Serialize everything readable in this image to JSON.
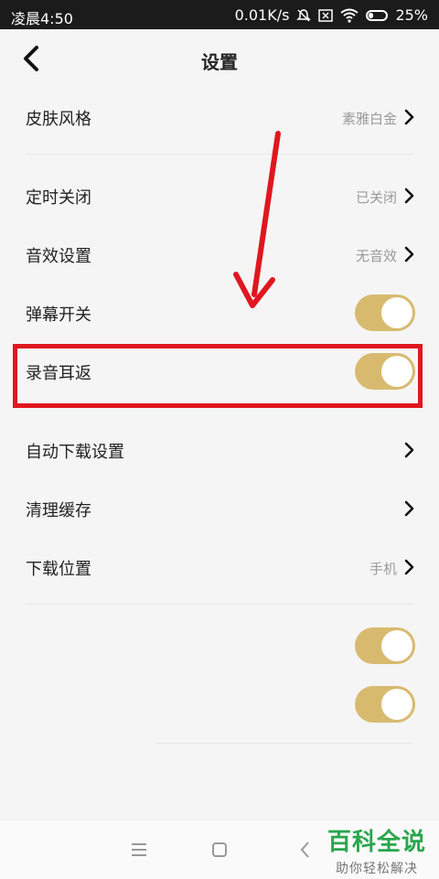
{
  "status_bar": {
    "time": "凌晨4:50",
    "network_speed": "0.01K/s",
    "battery": "25%"
  },
  "header": {
    "title": "设置"
  },
  "settings": {
    "skin": {
      "label": "皮肤风格",
      "value": "素雅白金"
    },
    "timer": {
      "label": "定时关闭",
      "value": "已关闭"
    },
    "sound_effect": {
      "label": "音效设置",
      "value": "无音效"
    },
    "danmaku": {
      "label": "弹幕开关",
      "on": true
    },
    "ear_return": {
      "label": "录音耳返",
      "on": true
    },
    "auto_download": {
      "label": "自动下载设置"
    },
    "clear_cache": {
      "label": "清理缓存"
    },
    "download_location": {
      "label": "下载位置",
      "value": "手机"
    },
    "toggle_a": {
      "on": true
    },
    "toggle_b": {
      "on": true
    }
  },
  "watermark": {
    "main": "百科全说",
    "sub": "助你轻松解决"
  },
  "colors": {
    "accent": "#d8ba6f",
    "highlight": "#e0171f",
    "watermark": "#2aa64d"
  }
}
